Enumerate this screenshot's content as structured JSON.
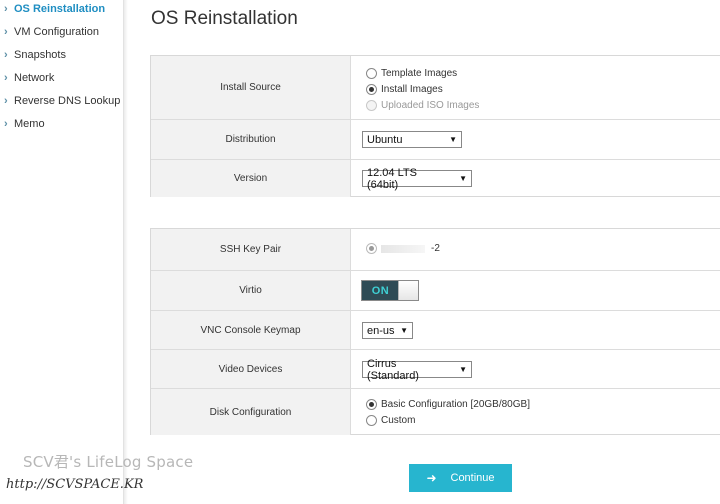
{
  "sidebar": {
    "items": [
      {
        "label": "OS Reinstallation",
        "active": true
      },
      {
        "label": "VM Configuration"
      },
      {
        "label": "Snapshots"
      },
      {
        "label": "Network"
      },
      {
        "label": "Reverse DNS Lookup"
      },
      {
        "label": "Memo"
      }
    ]
  },
  "page_title": "OS Reinstallation",
  "install_source": {
    "label": "Install Source",
    "options": [
      {
        "label": "Template Images",
        "selected": false,
        "disabled": false
      },
      {
        "label": "Install Images",
        "selected": true,
        "disabled": false
      },
      {
        "label": "Uploaded ISO Images",
        "selected": false,
        "disabled": true
      }
    ]
  },
  "distribution": {
    "label": "Distribution",
    "value": "Ubuntu"
  },
  "version": {
    "label": "Version",
    "value": "12.04 LTS (64bit)"
  },
  "ssh_key_pair": {
    "label": "SSH Key Pair",
    "value": "-2"
  },
  "virtio": {
    "label": "Virtio",
    "state": "ON"
  },
  "vnc_keymap": {
    "label": "VNC Console Keymap",
    "value": "en-us"
  },
  "video_devices": {
    "label": "Video Devices",
    "value": "Cirrus (Standard)"
  },
  "disk_configuration": {
    "label": "Disk Configuration",
    "options": [
      {
        "label": "Basic Configuration [20GB/80GB]",
        "selected": true
      },
      {
        "label": "Custom",
        "selected": false
      }
    ]
  },
  "continue_button": "Continue",
  "watermark": {
    "line1": "SCV君's LifeLog Space",
    "line2": "http://SCVSPACE.KR"
  },
  "colors": {
    "accent": "#1f8ec2",
    "button": "#27b5cf",
    "toggle_bg": "#2f4b55",
    "toggle_text": "#3fd0d4"
  }
}
